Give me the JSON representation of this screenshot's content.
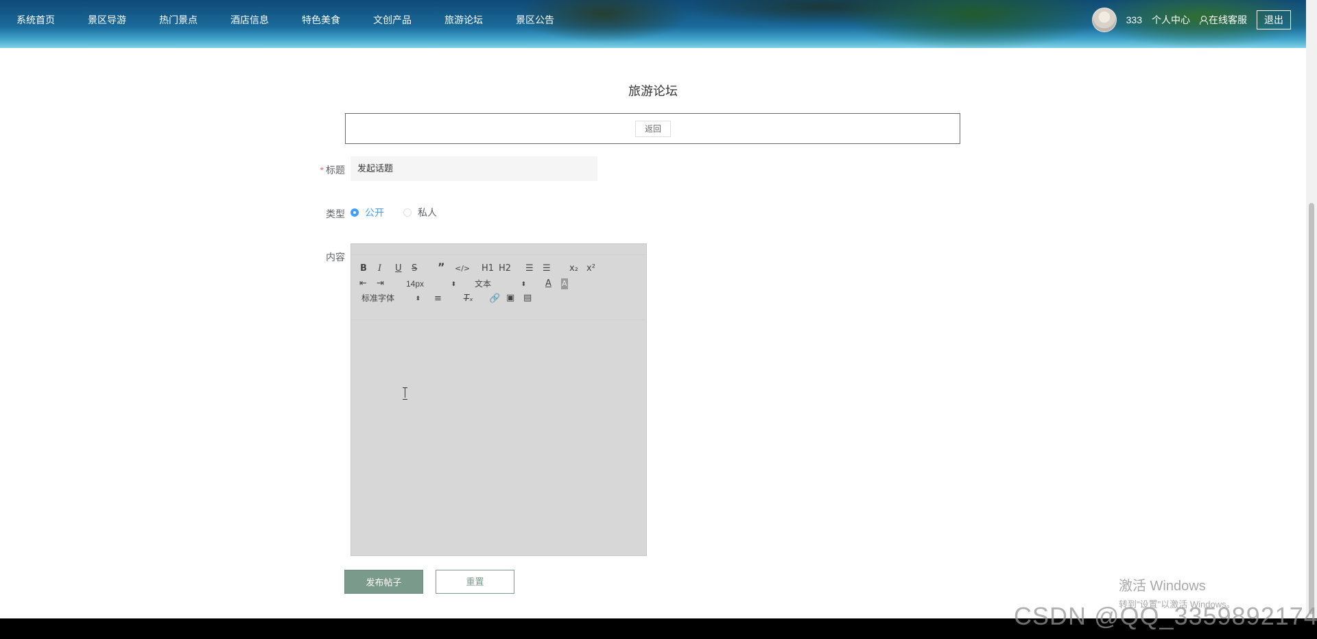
{
  "nav": {
    "items": [
      "系统首页",
      "景区导游",
      "热门景点",
      "酒店信息",
      "特色美食",
      "文创产品",
      "旅游论坛",
      "景区公告"
    ]
  },
  "user": {
    "name": "333",
    "profile": "个人中心",
    "service": "在线客服",
    "logout": "退出"
  },
  "page": {
    "title": "旅游论坛",
    "back": "返回"
  },
  "form": {
    "title_label": "标题",
    "title_value": "发起话题",
    "type_label": "类型",
    "type_options": [
      "公开",
      "私人"
    ],
    "type_selected": "公开",
    "content_label": "内容"
  },
  "editor": {
    "font_size": "14px",
    "block_type": "文本",
    "font_family": "标准字体",
    "h1": "H1",
    "h2": "H2"
  },
  "buttons": {
    "submit": "发布帖子",
    "reset": "重置"
  },
  "watermark": {
    "activate_title": "激活 Windows",
    "activate_sub": "转到\"设置\"以激活 Windows。",
    "csdn": "CSDN @QQ_3359892174"
  },
  "colors": {
    "primary": "#7a9a8b",
    "radio_active": "#409eff",
    "required": "#f56c6c"
  }
}
